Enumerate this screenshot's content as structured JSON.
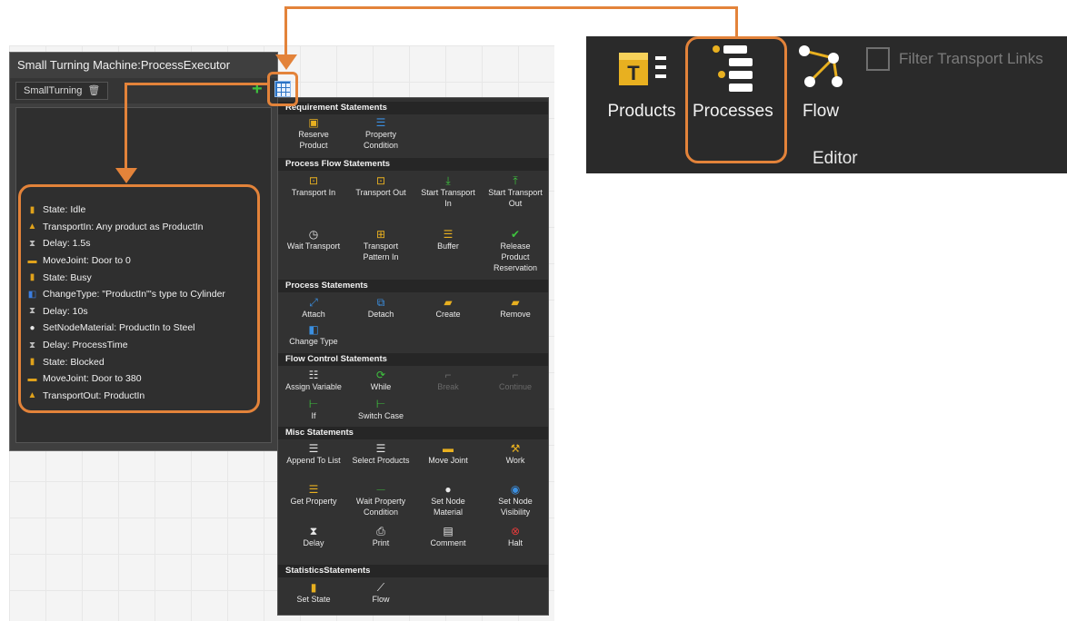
{
  "executor": {
    "title": "Small Turning Machine:ProcessExecutor",
    "tab_label": "SmallTurning",
    "statements": [
      {
        "icon": "state-icon",
        "text": "State: Idle"
      },
      {
        "icon": "transport-icon",
        "text": "TransportIn: Any product as ProductIn"
      },
      {
        "icon": "delay-icon",
        "text": "Delay: 1.5s"
      },
      {
        "icon": "joint-icon",
        "text": "MoveJoint: Door to 0"
      },
      {
        "icon": "state-icon",
        "text": "State: Busy"
      },
      {
        "icon": "change-type-icon",
        "text": "ChangeType: \"ProductIn\"'s type to Cylinder"
      },
      {
        "icon": "delay-icon",
        "text": "Delay: 10s"
      },
      {
        "icon": "material-icon",
        "text": "SetNodeMaterial: ProductIn to Steel"
      },
      {
        "icon": "delay-icon",
        "text": "Delay: ProcessTime"
      },
      {
        "icon": "state-icon",
        "text": "State: Blocked"
      },
      {
        "icon": "joint-icon",
        "text": "MoveJoint: Door to 380"
      },
      {
        "icon": "transport-icon",
        "text": "TransportOut: ProductIn"
      }
    ]
  },
  "menu": {
    "sections": [
      {
        "title": "Requirement Statements",
        "items": [
          {
            "l1": "Reserve",
            "l2": "Product",
            "icon": "reserve-product-icon"
          },
          {
            "l1": "Property",
            "l2": "Condition",
            "icon": "property-condition-icon"
          }
        ]
      },
      {
        "title": "Process Flow Statements",
        "items": [
          {
            "l1": "Transport In",
            "l2": "",
            "icon": "transport-in-icon"
          },
          {
            "l1": "Transport Out",
            "l2": "",
            "icon": "transport-out-icon"
          },
          {
            "l1": "Start Transport",
            "l2": "In",
            "icon": "start-transport-in-icon"
          },
          {
            "l1": "Start Transport",
            "l2": "Out",
            "icon": "start-transport-out-icon"
          },
          {
            "l1": "Wait Transport",
            "l2": "",
            "icon": "wait-transport-icon"
          },
          {
            "l1": "Transport",
            "l2": "Pattern In",
            "icon": "transport-pattern-icon"
          },
          {
            "l1": "Buffer",
            "l2": "",
            "icon": "buffer-icon"
          },
          {
            "l1": "Release",
            "l2": "Product",
            "l3": "Reservation",
            "icon": "release-icon"
          }
        ]
      },
      {
        "title": "Process Statements",
        "items": [
          {
            "l1": "Attach",
            "l2": "",
            "icon": "attach-icon"
          },
          {
            "l1": "Detach",
            "l2": "",
            "icon": "detach-icon"
          },
          {
            "l1": "Create",
            "l2": "",
            "icon": "create-icon"
          },
          {
            "l1": "Remove",
            "l2": "",
            "icon": "remove-icon"
          },
          {
            "l1": "Change Type",
            "l2": "",
            "icon": "change-type-icon"
          }
        ]
      },
      {
        "title": "Flow Control Statements",
        "items": [
          {
            "l1": "Assign Variable",
            "l2": "",
            "icon": "assign-variable-icon"
          },
          {
            "l1": "While",
            "l2": "",
            "icon": "while-icon"
          },
          {
            "l1": "Break",
            "l2": "",
            "icon": "break-icon",
            "disabled": true
          },
          {
            "l1": "Continue",
            "l2": "",
            "icon": "continue-icon",
            "disabled": true
          },
          {
            "l1": "If",
            "l2": "",
            "icon": "if-icon"
          },
          {
            "l1": "Switch Case",
            "l2": "",
            "icon": "switch-case-icon"
          }
        ]
      },
      {
        "title": "Misc Statements",
        "items": [
          {
            "l1": "Append To List",
            "l2": "",
            "icon": "append-list-icon"
          },
          {
            "l1": "Select Products",
            "l2": "",
            "icon": "select-products-icon"
          },
          {
            "l1": "Move Joint",
            "l2": "",
            "icon": "move-joint-icon"
          },
          {
            "l1": "Work",
            "l2": "",
            "icon": "work-icon"
          },
          {
            "l1": "Get Property",
            "l2": "",
            "icon": "get-property-icon"
          },
          {
            "l1": "Wait Property",
            "l2": "Condition",
            "icon": "wait-property-icon"
          },
          {
            "l1": "Set Node",
            "l2": "Material",
            "icon": "set-node-material-icon"
          },
          {
            "l1": "Set Node",
            "l2": "Visibility",
            "icon": "set-node-visibility-icon"
          },
          {
            "l1": "Delay",
            "l2": "",
            "icon": "delay-icon"
          },
          {
            "l1": "Print",
            "l2": "",
            "icon": "print-icon"
          },
          {
            "l1": "Comment",
            "l2": "",
            "icon": "comment-icon"
          },
          {
            "l1": "Halt",
            "l2": "",
            "icon": "halt-icon"
          }
        ]
      },
      {
        "title": "StatisticsStatements",
        "items": [
          {
            "l1": "Set State",
            "l2": "",
            "icon": "set-state-icon"
          },
          {
            "l1": "Flow",
            "l2": "",
            "icon": "flow-stat-icon"
          }
        ]
      }
    ]
  },
  "ribbon": {
    "products_label": "Products",
    "processes_label": "Processes",
    "flow_label": "Flow",
    "filter_label": "Filter Transport Links",
    "group_label": "Editor"
  },
  "colors": {
    "highlight": "#e3833a",
    "accent_blue": "#2a72c4",
    "green": "#3dc23d",
    "gold": "#e8b020"
  }
}
